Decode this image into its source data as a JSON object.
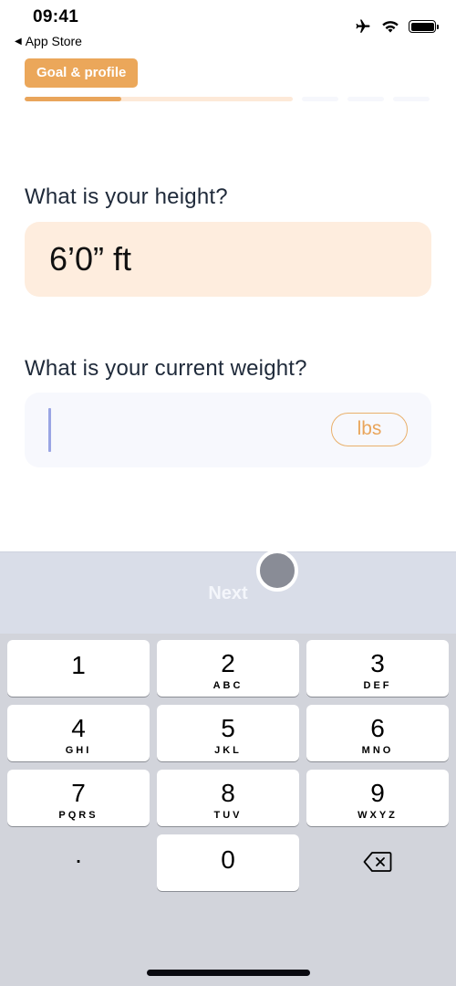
{
  "status_bar": {
    "time": "09:41",
    "back_app": "App Store",
    "icons": [
      "airplane-icon",
      "wifi-icon",
      "battery-icon"
    ]
  },
  "header": {
    "section_label": "Goal & profile",
    "progress": {
      "current_segment_fill_fraction": 0.36,
      "segments": 4
    }
  },
  "form": {
    "height": {
      "question": "What is your height?",
      "value": "6’0” ft"
    },
    "weight": {
      "question": "What is your current weight?",
      "value": "",
      "unit": "lbs"
    }
  },
  "keyboard_accessory": {
    "next_label": "Next"
  },
  "keyboard": {
    "keys": [
      {
        "digit": "1",
        "letters": ""
      },
      {
        "digit": "2",
        "letters": "ABC"
      },
      {
        "digit": "3",
        "letters": "DEF"
      },
      {
        "digit": "4",
        "letters": "GHI"
      },
      {
        "digit": "5",
        "letters": "JKL"
      },
      {
        "digit": "6",
        "letters": "MNO"
      },
      {
        "digit": "7",
        "letters": "PQRS"
      },
      {
        "digit": "8",
        "letters": "TUV"
      },
      {
        "digit": "9",
        "letters": "WXYZ"
      },
      {
        "digit": ".",
        "letters": ""
      },
      {
        "digit": "0",
        "letters": ""
      },
      {
        "digit": "",
        "letters": "",
        "icon": "backspace-icon"
      }
    ]
  },
  "colors": {
    "accent": "#eba75a",
    "height_field_bg": "#feedde",
    "weight_field_bg": "#f7f8fd",
    "caret": "#9aa5e4",
    "keyboard_bg": "#d2d4db",
    "accessory_bg": "#d9dde8"
  }
}
